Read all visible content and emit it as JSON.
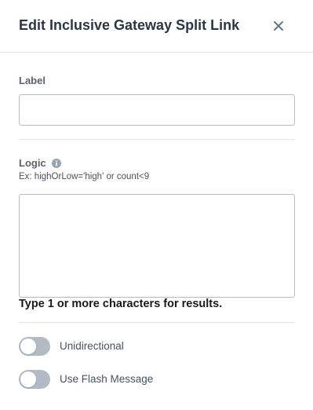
{
  "header": {
    "title": "Edit Inclusive Gateway Split Link",
    "close_icon": "close-icon"
  },
  "form": {
    "label_field": {
      "label": "Label",
      "value": "",
      "placeholder": ""
    },
    "logic_field": {
      "label": "Logic",
      "info_icon": "info-icon",
      "helper": "Ex: highOrLow='high' or count<9",
      "value": "",
      "placeholder": ""
    },
    "search_hint": "Type 1 or more characters for results.",
    "toggles": [
      {
        "label": "Unidirectional",
        "checked": false
      },
      {
        "label": "Use Flash Message",
        "checked": false
      }
    ]
  },
  "colors": {
    "toggle_off": "#b2bbc5",
    "accent_icon": "#5b7a8c",
    "border": "#b5bcc4",
    "divider": "#e3e6ea"
  }
}
